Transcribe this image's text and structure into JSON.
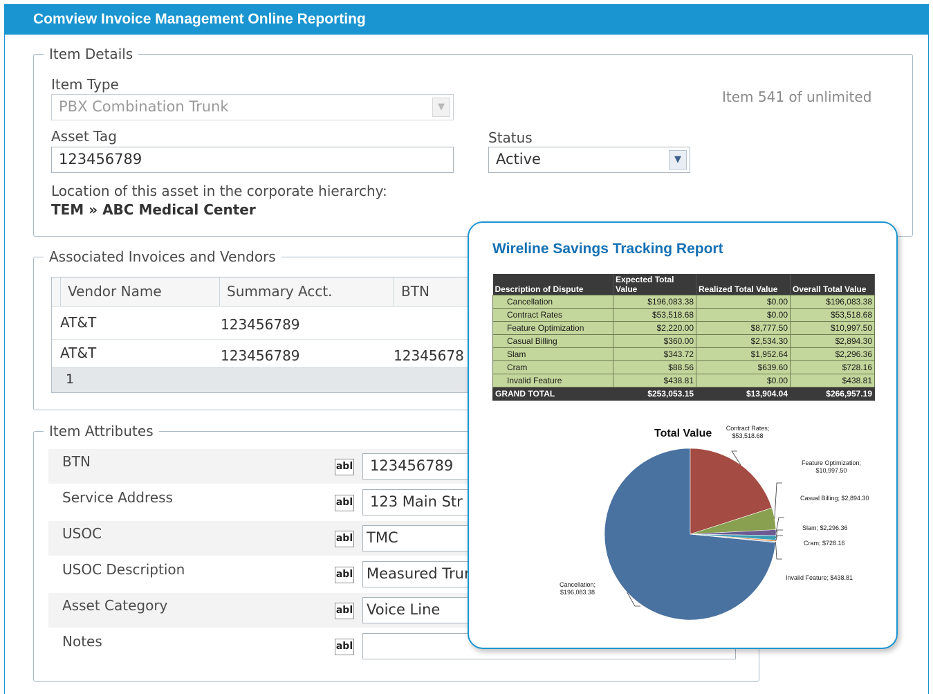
{
  "app": {
    "title": "Comview Invoice Management Online Reporting"
  },
  "item_details": {
    "legend": "Item Details",
    "item_type_label": "Item Type",
    "item_type_value": "PBX Combination Trunk",
    "item_count": "Item 541 of unlimited",
    "asset_tag_label": "Asset Tag",
    "asset_tag_value": "123456789",
    "status_label": "Status",
    "status_value": "Active",
    "location_label": "Location of this asset in the corporate hierarchy:",
    "location_root": "TEM",
    "location_separator": "»",
    "location_leaf": "ABC Medical Center"
  },
  "invoices": {
    "legend": "Associated Invoices and Vendors",
    "columns": [
      "Vendor Name",
      "Summary Acct.",
      "BTN"
    ],
    "rows": [
      {
        "vendor": "AT&T",
        "summary": "123456789",
        "btn": ""
      },
      {
        "vendor": "AT&T",
        "summary": "123456789",
        "btn": "12345678"
      }
    ],
    "page": "1"
  },
  "attributes": {
    "legend": "Item Attributes",
    "abl": "abl",
    "rows": [
      {
        "label": "BTN",
        "value": "123456789"
      },
      {
        "label": "Service Address",
        "value": "123 Main Str"
      },
      {
        "label": "USOC",
        "value": "TMC"
      },
      {
        "label": "USOC Description",
        "value": "Measured Trur"
      },
      {
        "label": "Asset Category",
        "value": "Voice Line"
      },
      {
        "label": "Notes",
        "value": ""
      }
    ]
  },
  "report": {
    "title": "Wireline Savings Tracking Report",
    "table_headers": [
      "Description of Dispute",
      "Expected Total Value",
      "Realized Total Value",
      "Overall Total Value"
    ],
    "table_rows": [
      [
        "Cancellation",
        "$196,083.38",
        "$0.00",
        "$196,083.38"
      ],
      [
        "Contract Rates",
        "$53,518.68",
        "$0.00",
        "$53,518.68"
      ],
      [
        "Feature Optimization",
        "$2,220.00",
        "$8,777.50",
        "$10,997.50"
      ],
      [
        "Casual Billing",
        "$360.00",
        "$2,534.30",
        "$2,894.30"
      ],
      [
        "Slam",
        "$343.72",
        "$1,952.64",
        "$2,296.36"
      ],
      [
        "Cram",
        "$88.56",
        "$639.60",
        "$728.16"
      ],
      [
        "Invalid Feature",
        "$438.81",
        "$0.00",
        "$438.81"
      ]
    ],
    "grand_total": [
      "GRAND TOTAL",
      "$253,053.15",
      "$13,904.04",
      "$266,957.19"
    ]
  },
  "chart_data": {
    "type": "pie",
    "title": "Total Value",
    "categories": [
      "Cancellation",
      "Contract Rates",
      "Feature Optimization",
      "Casual Billing",
      "Slam",
      "Cram",
      "Invalid Feature"
    ],
    "values": [
      196083.38,
      53518.68,
      10997.5,
      2894.3,
      2296.36,
      728.16,
      438.81
    ],
    "labels": [
      "Cancellation; $196,083.38",
      "Contract Rates; $53,518.68",
      "Feature Optimization; $10,997.50",
      "Casual Billing; $2,894.30",
      "Slam; $2,296.36",
      "Cram; $728.16",
      "Invalid Feature; $438.81"
    ],
    "colors": [
      "#4a72a0",
      "#a44b43",
      "#88a050",
      "#6d5a92",
      "#3d9db5",
      "#e08a3a",
      "#9ab0d2"
    ]
  }
}
